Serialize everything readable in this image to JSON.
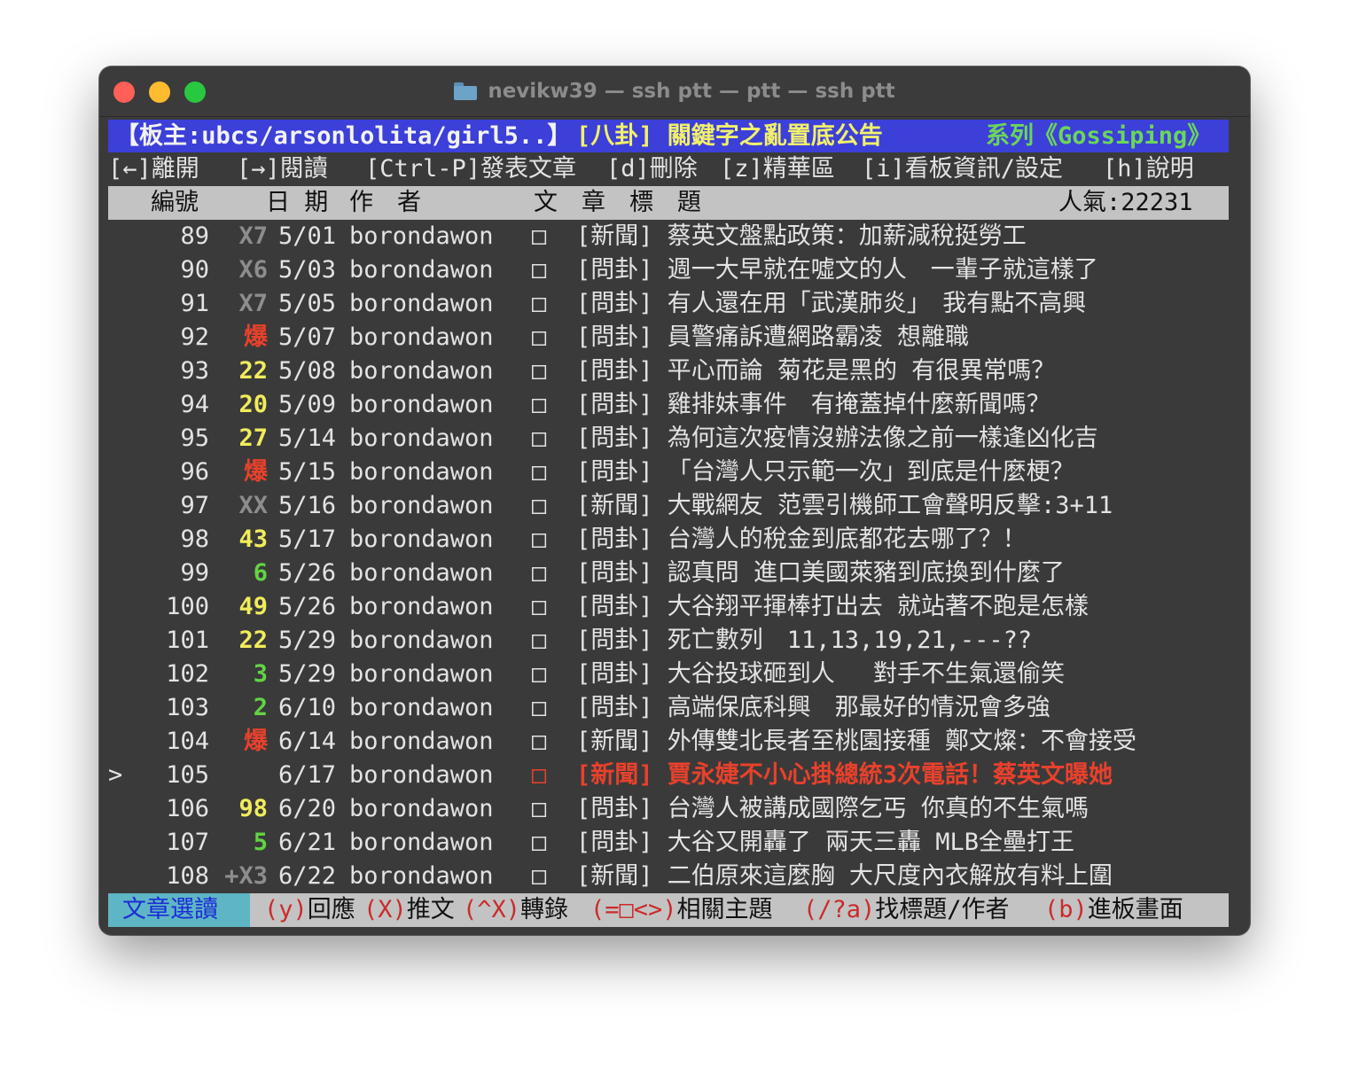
{
  "window": {
    "title": "nevikw39 — ssh ptt — ptt — ssh ptt",
    "folder_icon": "folder-icon"
  },
  "header": {
    "moderators": "【板主:ubcs/arsonlolita/girl5..】",
    "announcement": "[八卦] 關鍵字之亂置底公告",
    "series": "系列《Gossiping》"
  },
  "menu": [
    {
      "key": "[←]",
      "label": "離開"
    },
    {
      "key": "[→]",
      "label": "閱讀"
    },
    {
      "key": "[Ctrl-P]",
      "label": "發表文章"
    },
    {
      "key": "[d]",
      "label": "刪除"
    },
    {
      "key": "[z]",
      "label": "精華區"
    },
    {
      "key": "[i]",
      "label": "看板資訊/設定"
    },
    {
      "key": "[h]",
      "label": "說明"
    }
  ],
  "columns": {
    "number": "編號",
    "date": "日 期",
    "author": "作　者",
    "title": "文　章　標　題",
    "popularity": "人氣:22231"
  },
  "posts": [
    {
      "num": "89",
      "rec": "X7",
      "rec_color": "gray",
      "date": "5/01",
      "author": "borondawon",
      "box": "□",
      "title": "[新聞] 蔡英文盤點政策：加薪減稅挺勞工"
    },
    {
      "num": "90",
      "rec": "X6",
      "rec_color": "gray",
      "date": "5/03",
      "author": "borondawon",
      "box": "□",
      "title": "[問卦] 週一大早就在噓文的人　一輩子就這樣了"
    },
    {
      "num": "91",
      "rec": "X7",
      "rec_color": "gray",
      "date": "5/05",
      "author": "borondawon",
      "box": "□",
      "title": "[問卦] 有人還在用「武漢肺炎」　我有點不高興"
    },
    {
      "num": "92",
      "rec": "爆",
      "rec_color": "red",
      "date": "5/07",
      "author": "borondawon",
      "box": "□",
      "title": "[問卦] 員警痛訴遭網路霸凌 想離職"
    },
    {
      "num": "93",
      "rec": "22",
      "rec_color": "yellow",
      "date": "5/08",
      "author": "borondawon",
      "box": "□",
      "title": "[問卦] 平心而論 菊花是黑的 有很異常嗎？"
    },
    {
      "num": "94",
      "rec": "20",
      "rec_color": "yellow",
      "date": "5/09",
      "author": "borondawon",
      "box": "□",
      "title": "[問卦] 雞排妹事件　有掩蓋掉什麼新聞嗎？"
    },
    {
      "num": "95",
      "rec": "27",
      "rec_color": "yellow",
      "date": "5/14",
      "author": "borondawon",
      "box": "□",
      "title": "[問卦] 為何這次疫情沒辦法像之前一樣逢凶化吉"
    },
    {
      "num": "96",
      "rec": "爆",
      "rec_color": "red",
      "date": "5/15",
      "author": "borondawon",
      "box": "□",
      "title": "[問卦] 「台灣人只示範一次」到底是什麼梗？"
    },
    {
      "num": "97",
      "rec": "XX",
      "rec_color": "gray",
      "date": "5/16",
      "author": "borondawon",
      "box": "□",
      "title": "[新聞] 大戰網友 范雲引機師工會聲明反擊:3+11"
    },
    {
      "num": "98",
      "rec": "43",
      "rec_color": "yellow",
      "date": "5/17",
      "author": "borondawon",
      "box": "□",
      "title": "[問卦] 台灣人的稅金到底都花去哪了？！"
    },
    {
      "num": "99",
      "rec": "6",
      "rec_color": "green",
      "date": "5/26",
      "author": "borondawon",
      "box": "□",
      "title": "[問卦] 認真問 進口美國萊豬到底換到什麼了"
    },
    {
      "num": "100",
      "rec": "49",
      "rec_color": "yellow",
      "date": "5/26",
      "author": "borondawon",
      "box": "□",
      "title": "[問卦] 大谷翔平揮棒打出去 就站著不跑是怎樣"
    },
    {
      "num": "101",
      "rec": "22",
      "rec_color": "yellow",
      "date": "5/29",
      "author": "borondawon",
      "box": "□",
      "title": "[問卦] 死亡數列　11,13,19,21,---??"
    },
    {
      "num": "102",
      "rec": "3",
      "rec_color": "green",
      "date": "5/29",
      "author": "borondawon",
      "box": "□",
      "title": "[問卦] 大谷投球砸到人　 對手不生氣還偷笑"
    },
    {
      "num": "103",
      "rec": "2",
      "rec_color": "green",
      "date": "6/10",
      "author": "borondawon",
      "box": "□",
      "title": "[問卦] 高端保底科興　那最好的情況會多強"
    },
    {
      "num": "104",
      "rec": "爆",
      "rec_color": "red",
      "date": "6/14",
      "author": "borondawon",
      "box": "□",
      "title": "[新聞] 外傳雙北長者至桃園接種 鄭文燦：不會接受"
    },
    {
      "num": "105",
      "rec": "",
      "rec_color": "gray",
      "date": "6/17",
      "author": "borondawon",
      "box": "□",
      "title": "[新聞] 賈永婕不小心掛總統3次電話！蔡英文曝她",
      "selected": true
    },
    {
      "num": "106",
      "rec": "98",
      "rec_color": "yellow",
      "date": "6/20",
      "author": "borondawon",
      "box": "□",
      "title": "[問卦] 台灣人被講成國際乞丐 你真的不生氣嗎"
    },
    {
      "num": "107",
      "rec": "5",
      "rec_color": "green",
      "date": "6/21",
      "author": "borondawon",
      "box": "□",
      "title": "[問卦] 大谷又開轟了 兩天三轟 MLB全壘打王"
    },
    {
      "num": "108",
      "rec": "+X3",
      "rec_color": "gray",
      "date": "6/22",
      "author": "borondawon",
      "box": "□",
      "title": "[新聞] 二伯原來這麼胸 大尺度內衣解放有料上圍"
    }
  ],
  "cursor": ">",
  "status": {
    "mode": "文章選讀",
    "items": [
      {
        "key": "(y)",
        "label": "回應"
      },
      {
        "key": "(X)",
        "label": "推文"
      },
      {
        "key": "(^X)",
        "label": "轉錄"
      },
      {
        "key": "(=□<>)",
        "label": "相關主題"
      },
      {
        "key": "(/?a)",
        "label": "找標題/作者"
      },
      {
        "key": "(b)",
        "label": "進板畫面"
      }
    ]
  },
  "colors": {
    "header_bg": "#3c3fd8",
    "rec_yellow": "#f1ec5b",
    "rec_green": "#62d445",
    "rec_red": "#e8412c",
    "rec_gray": "#8d8d8d",
    "selected": "#e8412c",
    "status_mode_bg": "#5eb6c4"
  }
}
